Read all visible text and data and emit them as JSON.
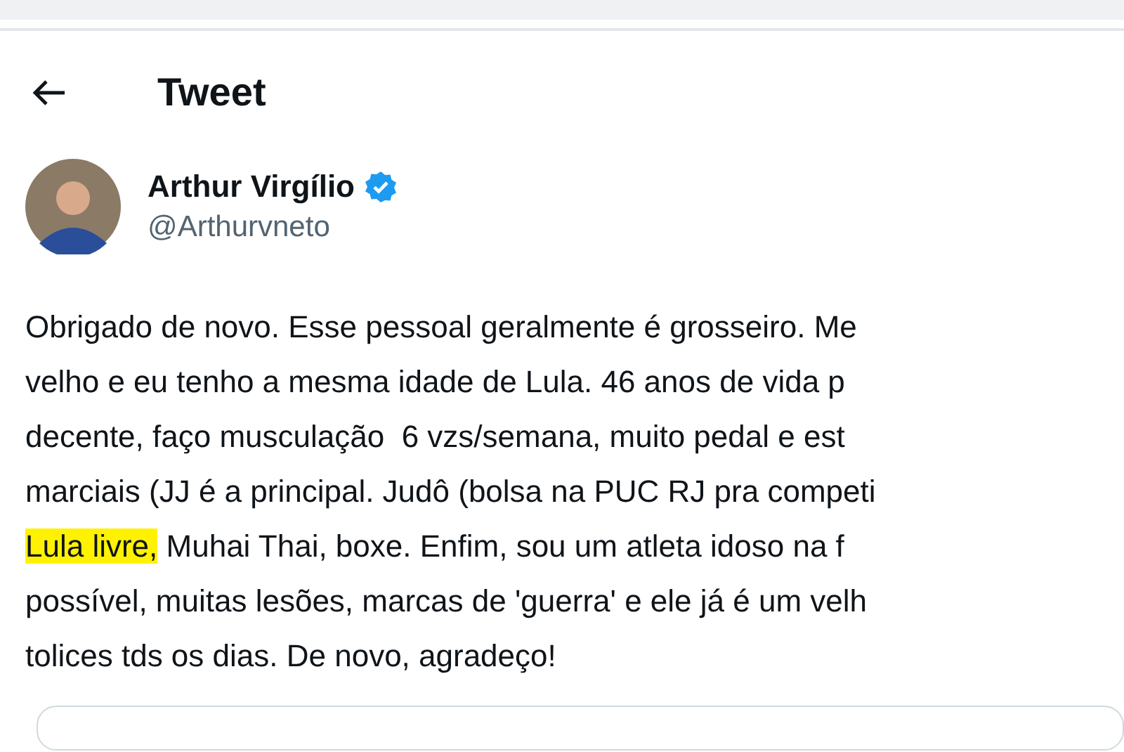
{
  "header": {
    "title": "Tweet"
  },
  "author": {
    "name": "Arthur Virgílio",
    "verified": true,
    "handle": "@Arthurvneto"
  },
  "tweet_lines": [
    {
      "segments": [
        {
          "text": "Obrigado de novo. Esse pessoal geralmente é grosseiro. Me",
          "highlighted": false
        }
      ]
    },
    {
      "segments": [
        {
          "text": "velho e eu tenho a mesma idade de Lula. 46 anos de vida p",
          "highlighted": false
        }
      ]
    },
    {
      "segments": [
        {
          "text": "decente, faço musculação  6 vzs/semana, muito pedal e est",
          "highlighted": false
        }
      ]
    },
    {
      "segments": [
        {
          "text": "marciais (JJ é a principal. Judô (bolsa na PUC RJ pra competi",
          "highlighted": false
        }
      ]
    },
    {
      "segments": [
        {
          "text": "Lula livre,",
          "highlighted": true
        },
        {
          "text": " Muhai Thai, boxe. Enfim, sou um atleta idoso na f",
          "highlighted": false
        }
      ]
    },
    {
      "segments": [
        {
          "text": "possível, muitas lesões, marcas de 'guerra' e ele já é um velh",
          "highlighted": false
        }
      ]
    },
    {
      "segments": [
        {
          "text": "tolices tds os dias. De novo, agradeço!",
          "highlighted": false
        }
      ]
    }
  ]
}
